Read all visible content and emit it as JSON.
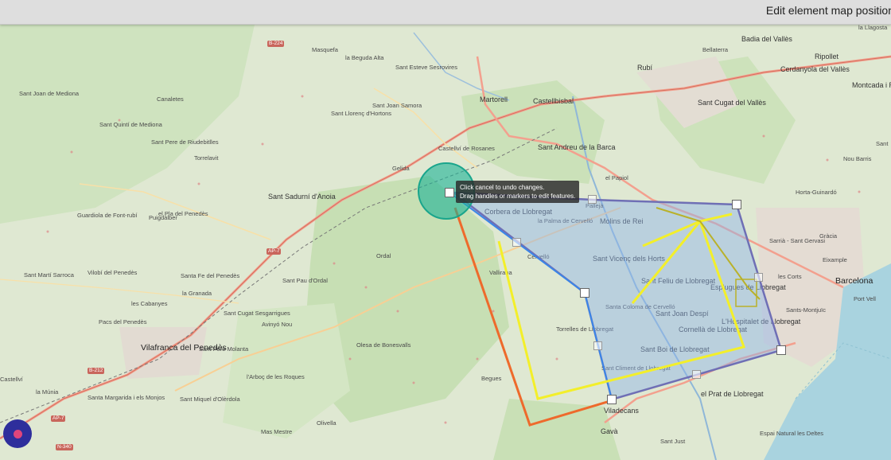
{
  "topbar": {
    "title": "Edit element map position"
  },
  "tooltip": {
    "line1": "Click cancel to undo changes.",
    "line2": "Drag handles or markers to edit features."
  },
  "colors": {
    "polygon_fill": "#8fb3ea",
    "polygon_stroke": "#6f6fb5",
    "blue_line": "#3a86e8",
    "orange_line": "#ee6a2c",
    "yellow_line": "#f3ef2a",
    "edit_circle": "#1bb296",
    "locator": "#2e2e9c",
    "locator_dot": "#e0457b"
  },
  "map": {
    "labels": [
      {
        "text": "B-224",
        "kind": "road"
      },
      {
        "text": "Masquefa",
        "kind": "place"
      },
      {
        "text": "la Beguda Alta",
        "kind": "place"
      },
      {
        "text": "Sant Esteve Sesrovires",
        "kind": "place"
      },
      {
        "text": "Martorell",
        "kind": "town"
      },
      {
        "text": "Castellbisbal",
        "kind": "town"
      },
      {
        "text": "Rubí",
        "kind": "town"
      },
      {
        "text": "Badia del Vallès",
        "kind": "town"
      },
      {
        "text": "la Llagosta",
        "kind": "place"
      },
      {
        "text": "Bellaterra",
        "kind": "place"
      },
      {
        "text": "Ripollet",
        "kind": "town"
      },
      {
        "text": "Cerdanyola del Vallès",
        "kind": "town"
      },
      {
        "text": "Montcada i Reixac",
        "kind": "town"
      },
      {
        "text": "Sant Joan de Mediona",
        "kind": "place"
      },
      {
        "text": "Canaletes",
        "kind": "place"
      },
      {
        "text": "Sant Joan Samora",
        "kind": "place"
      },
      {
        "text": "Sant Llorenç d'Hortons",
        "kind": "place"
      },
      {
        "text": "Sant Cugat del Vallès",
        "kind": "town"
      },
      {
        "text": "Sant Quintí de Mediona",
        "kind": "place"
      },
      {
        "text": "Sant Pere de Riudebitlles",
        "kind": "place"
      },
      {
        "text": "Castellví de Rosanes",
        "kind": "place"
      },
      {
        "text": "Sant Andreu de la Barca",
        "kind": "town"
      },
      {
        "text": "Torrelavit",
        "kind": "place"
      },
      {
        "text": "Gelida",
        "kind": "place"
      },
      {
        "text": "el Papiol",
        "kind": "place"
      },
      {
        "text": "Sant Sadurní d'Anoia",
        "kind": "town"
      },
      {
        "text": "Pallejà",
        "kind": "place"
      },
      {
        "text": "Horta-Guinardó",
        "kind": "place"
      },
      {
        "text": "Nou Barris",
        "kind": "place"
      },
      {
        "text": "Corbera de Llobregat",
        "kind": "town"
      },
      {
        "text": "la Palma de Cervelló",
        "kind": "place"
      },
      {
        "text": "Molins de Rei",
        "kind": "town"
      },
      {
        "text": "Guardiola de Font-rubí",
        "kind": "place"
      },
      {
        "text": "el Pla del Penedès",
        "kind": "place"
      },
      {
        "text": "Sarrià - Sant Gervasi",
        "kind": "place"
      },
      {
        "text": "Gràcia",
        "kind": "place"
      },
      {
        "text": "Puigdàlber",
        "kind": "place"
      },
      {
        "text": "Cervelló",
        "kind": "place"
      },
      {
        "text": "Sant Vicenç dels Horts",
        "kind": "town"
      },
      {
        "text": "AP-7",
        "kind": "road"
      },
      {
        "text": "Ordal",
        "kind": "place"
      },
      {
        "text": "Eixample",
        "kind": "place"
      },
      {
        "text": "Sant Martí Sarroca",
        "kind": "place"
      },
      {
        "text": "Vilobí del Penedès",
        "kind": "place"
      },
      {
        "text": "Santa Fe del Penedès",
        "kind": "place"
      },
      {
        "text": "Sant Pau d'Ordal",
        "kind": "place"
      },
      {
        "text": "Vallirana",
        "kind": "place"
      },
      {
        "text": "Sant Feliu de Llobregat",
        "kind": "town"
      },
      {
        "text": "Esplugues de Llobregat",
        "kind": "town"
      },
      {
        "text": "les Corts",
        "kind": "place"
      },
      {
        "text": "Barcelona",
        "kind": "city"
      },
      {
        "text": "la Granada",
        "kind": "place"
      },
      {
        "text": "Sant Joan Despí",
        "kind": "town"
      },
      {
        "text": "Port Vell",
        "kind": "place"
      },
      {
        "text": "les Cabanyes",
        "kind": "place"
      },
      {
        "text": "Santa Coloma de Cervelló",
        "kind": "place"
      },
      {
        "text": "Sants-Montjuïc",
        "kind": "place"
      },
      {
        "text": "Sant Cugat Sesgarrigues",
        "kind": "place"
      },
      {
        "text": "Pacs del Penedès",
        "kind": "place"
      },
      {
        "text": "Avinyó Nou",
        "kind": "place"
      },
      {
        "text": "L'Hospitalet de Llobregat",
        "kind": "town"
      },
      {
        "text": "Cornellà de Llobregat",
        "kind": "town"
      },
      {
        "text": "Torrelles de Llobregat",
        "kind": "place"
      },
      {
        "text": "Vilafranca del Penedès",
        "kind": "city"
      },
      {
        "text": "Sant Pere Molanta",
        "kind": "place"
      },
      {
        "text": "Olesa de Bonesvalls",
        "kind": "place"
      },
      {
        "text": "Sant Boi de Llobregat",
        "kind": "town"
      },
      {
        "text": "B-212",
        "kind": "road"
      },
      {
        "text": "Sant Climent de Llobregat",
        "kind": "place"
      },
      {
        "text": "l'Arboç de les Roques",
        "kind": "place"
      },
      {
        "text": "Castellví",
        "kind": "place"
      },
      {
        "text": "Begues",
        "kind": "place"
      },
      {
        "text": "la Múnia",
        "kind": "place"
      },
      {
        "text": "el Prat de Llobregat",
        "kind": "town"
      },
      {
        "text": "Santa Margarida i els Monjos",
        "kind": "place"
      },
      {
        "text": "Sant Miquel d'Olèrdola",
        "kind": "place"
      },
      {
        "text": "Viladecans",
        "kind": "town"
      },
      {
        "text": "AP-7",
        "kind": "road"
      },
      {
        "text": "Olivella",
        "kind": "place"
      },
      {
        "text": "Espai Natural les Deltes",
        "kind": "place"
      },
      {
        "text": "N-340",
        "kind": "road"
      },
      {
        "text": "Gavà",
        "kind": "town"
      },
      {
        "text": "Mas Mestre",
        "kind": "place"
      },
      {
        "text": "Sant Just",
        "kind": "place"
      },
      {
        "text": "Sant",
        "kind": "place"
      }
    ]
  }
}
